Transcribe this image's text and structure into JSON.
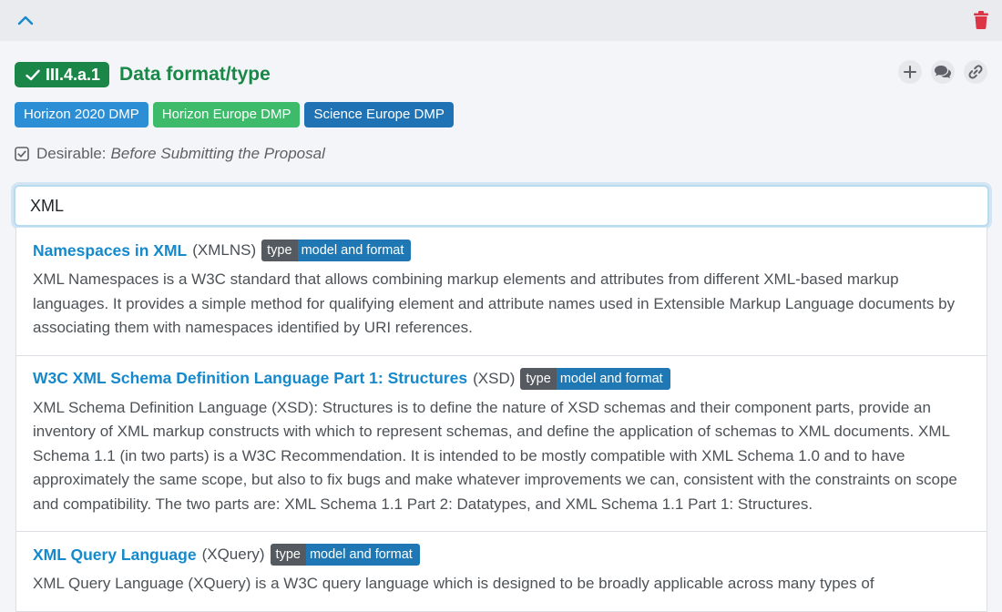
{
  "colors": {
    "accent": "#1589cb",
    "success": "#1a8647",
    "danger": "#dc3545",
    "tag_h2020": "#2c8fd6",
    "tag_horizon_europe": "#3dbb6b",
    "tag_science_europe": "#1f72b3"
  },
  "topbar": {
    "collapse_icon": "chevron-up-icon",
    "delete_icon": "trash-icon"
  },
  "question": {
    "id": "III.4.a.1",
    "title": "Data format/type",
    "tags": [
      "Horizon 2020 DMP",
      "Horizon Europe DMP",
      "Science Europe DMP"
    ],
    "desirable_label": "Desirable:",
    "desirable_phase": "Before Submitting the Proposal"
  },
  "actions": [
    "add-icon",
    "comments-icon",
    "link-icon"
  ],
  "search": {
    "value": "XML "
  },
  "results": [
    {
      "title": "Namespaces in XML",
      "abbr": "(XMLNS)",
      "type_key": "type",
      "type_value": "model and format",
      "description": "XML Namespaces is a W3C standard that allows combining markup elements and attributes from different XML-based markup languages. It provides a simple method for qualifying element and attribute names used in Extensible Markup Language documents by associating them with namespaces identified by URI references."
    },
    {
      "title": "W3C XML Schema Definition Language Part 1: Structures",
      "abbr": "(XSD)",
      "type_key": "type",
      "type_value": "model and format",
      "description": "XML Schema Definition Language (XSD): Structures is to define the nature of XSD schemas and their component parts, provide an inventory of XML markup constructs with which to represent schemas, and define the application of schemas to XML documents. XML Schema 1.1 (in two parts) is a W3C Recommendation. It is intended to be mostly compatible with XML Schema 1.0 and to have approximately the same scope, but also to fix bugs and make whatever improvements we can, consistent with the constraints on scope and compatibility. The two parts are: XML Schema 1.1 Part 2: Datatypes, and XML Schema 1.1 Part 1: Structures."
    },
    {
      "title": "XML Query Language",
      "abbr": "(XQuery)",
      "type_key": "type",
      "type_value": "model and format",
      "description": "XML Query Language (XQuery) is a W3C query language which is designed to be broadly applicable across many types of"
    }
  ]
}
